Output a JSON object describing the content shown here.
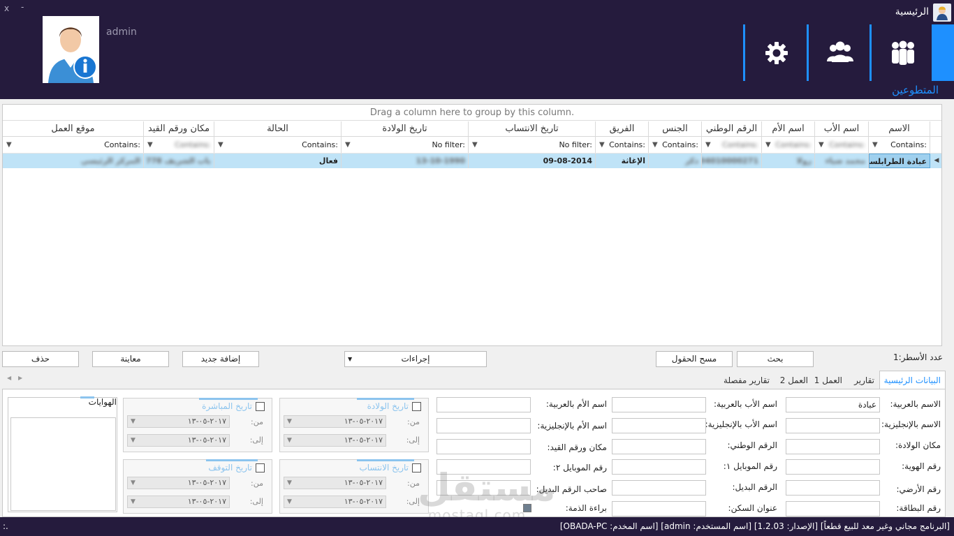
{
  "window": {
    "close": "x",
    "minimize": "-"
  },
  "header": {
    "app_title": "الرئيسية",
    "user": "admin",
    "nav_caption": "المتطوعين",
    "nav": [
      {
        "name": "volunteers-icon"
      },
      {
        "name": "users-icon"
      },
      {
        "name": "settings-icon"
      }
    ],
    "accent": "#1e90ff",
    "bg": "#251b3d"
  },
  "grid": {
    "group_hint": "Drag a column here to group by this column.",
    "columns": [
      "الاسم",
      "اسم الأب",
      "اسم الأم",
      "الرقم الوطني",
      "الجنس",
      "الفريق",
      "تاريخ الانتساب",
      "تاريخ الولادة",
      "الحالة",
      "مكان ورقم القيد",
      "موقع العمل"
    ],
    "filters": [
      "Contains:",
      "Contains:",
      "Contains:",
      "Contains:",
      "Contains:",
      "Contains:",
      "No filter:",
      "No filter:",
      "Contains:",
      "Contains:",
      "Contains:"
    ],
    "row": [
      "عبادة الطرابلسي",
      "محمد ضياء",
      "رولا",
      "04010000271",
      "ذكر",
      "الإغاثة",
      "09-08-2014",
      "13-10-1990",
      "فعال",
      "باب الشريف 778",
      "المركز الرئيسي"
    ]
  },
  "actions": {
    "delete": "حذف",
    "preview": "معاينة",
    "add_new": "إضافة جديد",
    "procedures": "إجراءات",
    "clear_fields": "مسح الحقول",
    "search": "بحث",
    "row_count": "عدد الأسطر:1"
  },
  "tabs": [
    "البيانات الرئيسية",
    "تقارير",
    "العمل 1",
    "العمل 2",
    "تقارير مفصلة"
  ],
  "form": {
    "col1": [
      {
        "label": "الاسم بالعربية:",
        "value": "عبادة"
      },
      {
        "label": "الاسم بالإنجليزية:",
        "value": ""
      },
      {
        "label": "مكان الولادة:",
        "value": ""
      },
      {
        "label": "رقم الهوية:",
        "value": ""
      },
      {
        "label": "رقم الأرضي:",
        "value": ""
      },
      {
        "label": "رقم البطاقة:",
        "value": ""
      }
    ],
    "col2": [
      {
        "label": "اسم الأب بالعربية:",
        "value": ""
      },
      {
        "label": "اسم الأب بالإنجليزية:",
        "value": ""
      },
      {
        "label": "الرقم الوطني:",
        "value": ""
      },
      {
        "label": "رقم الموبايل ١:",
        "value": ""
      },
      {
        "label": "الرقم البديل:",
        "value": ""
      },
      {
        "label": "عنوان السكن:",
        "value": ""
      }
    ],
    "col3": [
      {
        "label": "اسم الأم بالعربية:",
        "value": ""
      },
      {
        "label": "اسم الأم بالإنجليزية:",
        "value": ""
      },
      {
        "label": "مكان ورقم القيد:",
        "value": ""
      },
      {
        "label": "رقم الموبايل ٢:",
        "value": ""
      },
      {
        "label": "صاحب الرقم البديل:",
        "value": ""
      },
      {
        "label": "براءة الذمة:",
        "value": ""
      }
    ],
    "date_groups": {
      "birth": {
        "title": "تاريخ الولادة",
        "from_label": "من:",
        "to_label": "إلى:",
        "from": "٢٠١٧-٠٥-١٣",
        "to": "٢٠١٧-٠٥-١٣"
      },
      "start": {
        "title": "تاريخ المباشرة",
        "from_label": "من:",
        "to_label": "إلى:",
        "from": "٢٠١٧-٠٥-١٣",
        "to": "٢٠١٧-٠٥-١٣"
      },
      "join": {
        "title": "تاريخ الانتساب",
        "from_label": "من:",
        "to_label": "إلى:",
        "from": "٢٠١٧-٠٥-١٣",
        "to": "٢٠١٧-٠٥-١٣"
      },
      "stop": {
        "title": "تاريخ التوقف",
        "from_label": "من:",
        "to_label": "إلى:",
        "from": "٢٠١٧-٠٥-١٣",
        "to": "٢٠١٧-٠٥-١٣"
      }
    },
    "hobbies_title": "الهوايات"
  },
  "watermark": {
    "ar": "مستقل",
    "en": "mostaql.com"
  },
  "status": {
    "text": "[البرنامج مجاني وغير معد للبيع قطعاً] [الإصدار: 1.2.03] [اسم المستخدم: admin] [اسم المخدم: OBADA-PC]",
    "left": ":."
  }
}
